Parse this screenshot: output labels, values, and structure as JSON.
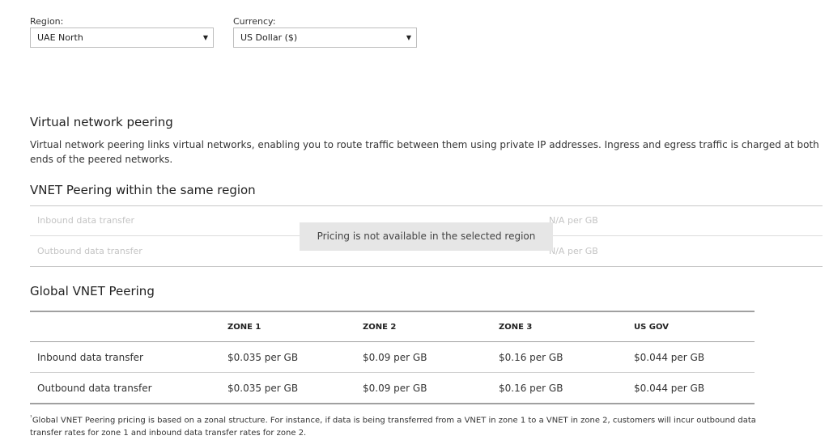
{
  "filters": {
    "region_label": "Region:",
    "region_value": "UAE North",
    "currency_label": "Currency:",
    "currency_value": "US Dollar ($)",
    "caret": "▼"
  },
  "vnet": {
    "title": "Virtual network peering",
    "description": "Virtual network peering links virtual networks, enabling you to route traffic between them using private IP addresses. Ingress and egress traffic is charged at both ends of the peered networks."
  },
  "same_region": {
    "title": "VNET Peering within the same region",
    "rows": [
      {
        "label": "Inbound data transfer",
        "price": "N/A per GB"
      },
      {
        "label": "Outbound data transfer",
        "price": "N/A per GB"
      }
    ],
    "unavailable_message": "Pricing is not available in the selected region"
  },
  "global": {
    "title": "Global VNET Peering",
    "headers": [
      "",
      "ZONE 1",
      "ZONE 2",
      "ZONE 3",
      "US GOV"
    ],
    "rows": [
      {
        "label": "Inbound data transfer",
        "zone1": "$0.035 per GB",
        "zone2": "$0.09 per GB",
        "zone3": "$0.16 per GB",
        "usgov": "$0.044 per GB"
      },
      {
        "label": "Outbound data transfer",
        "zone1": "$0.035 per GB",
        "zone2": "$0.09 per GB",
        "zone3": "$0.16 per GB",
        "usgov": "$0.044 per GB"
      }
    ],
    "footnote_mark": "¹",
    "footnote": "Global VNET Peering pricing is based on a zonal structure. For instance, if data is being transferred from a VNET in zone 1 to a VNET in zone 2, customers will incur outbound data transfer rates for zone 1 and inbound data transfer rates for zone 2."
  }
}
